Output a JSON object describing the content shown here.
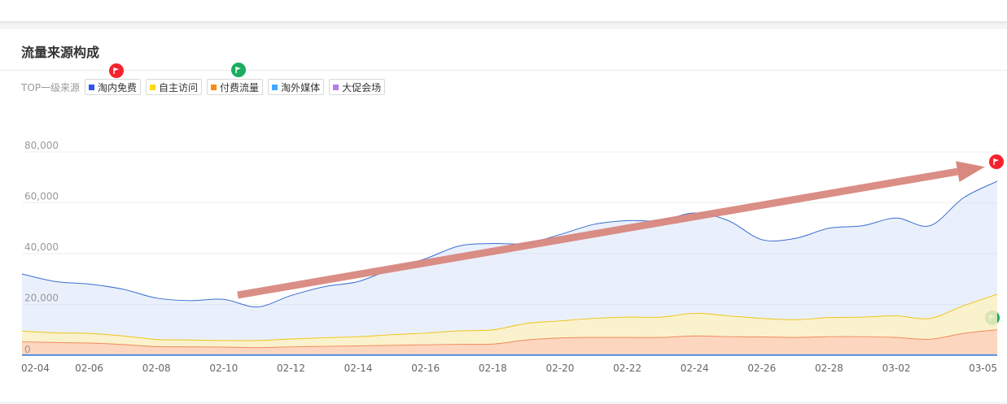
{
  "header": {
    "title": "流量来源构成"
  },
  "legend": {
    "label": "TOP一级来源",
    "items": [
      {
        "label": "淘内免费",
        "color": "#2f54eb"
      },
      {
        "label": "自主访问",
        "color": "#fadb14"
      },
      {
        "label": "付费流量",
        "color": "#fa8c16"
      },
      {
        "label": "淘外媒体",
        "color": "#40a9ff"
      },
      {
        "label": "大促会场",
        "color": "#b37feb"
      }
    ]
  },
  "flags": {
    "red_color": "#f5222d",
    "green_color": "#1aad5e"
  },
  "chart_data": {
    "type": "area",
    "title": "",
    "xlabel": "",
    "ylabel": "",
    "ylim": [
      0,
      80000
    ],
    "yticks": [
      "0",
      "20,000",
      "40,000",
      "60,000",
      "80,000"
    ],
    "xticks": [
      "02-04",
      "02-06",
      "02-08",
      "02-10",
      "02-12",
      "02-14",
      "02-16",
      "02-18",
      "02-20",
      "02-22",
      "02-24",
      "02-26",
      "02-28",
      "03-02",
      "03-05"
    ],
    "x": [
      "02-04",
      "02-05",
      "02-06",
      "02-07",
      "02-08",
      "02-09",
      "02-10",
      "02-11",
      "02-12",
      "02-13",
      "02-14",
      "02-15",
      "02-16",
      "02-17",
      "02-18",
      "02-19",
      "02-20",
      "02-21",
      "02-22",
      "02-23",
      "02-24",
      "02-25",
      "02-26",
      "02-27",
      "02-28",
      "03-01",
      "03-02",
      "03-03",
      "03-04",
      "03-05"
    ],
    "series": [
      {
        "name": "淘内免费",
        "color": "#3a6fcf",
        "values": [
          32000,
          29000,
          28000,
          26000,
          22500,
          21500,
          22000,
          19000,
          23500,
          27000,
          29000,
          34000,
          38000,
          43000,
          44000,
          44000,
          47500,
          51500,
          53000,
          53000,
          56000,
          53000,
          45500,
          46000,
          50000,
          51000,
          54000,
          51000,
          62000,
          68500
        ]
      },
      {
        "name": "自主访问",
        "color": "#f0c419",
        "values": [
          9500,
          8800,
          8600,
          7600,
          6200,
          6000,
          5800,
          5800,
          6400,
          6900,
          7300,
          8100,
          8700,
          9600,
          10000,
          12500,
          13500,
          14500,
          15000,
          15000,
          16500,
          15500,
          14500,
          14000,
          14800,
          15000,
          15500,
          14500,
          19500,
          24000
        ]
      },
      {
        "name": "付费流量",
        "color": "#f08a5d",
        "values": [
          5300,
          5000,
          4800,
          4200,
          3400,
          3300,
          3200,
          3000,
          3300,
          3500,
          3700,
          3900,
          4100,
          4300,
          4400,
          6000,
          6800,
          7000,
          7000,
          7000,
          7600,
          7300,
          7200,
          7000,
          7300,
          7300,
          7000,
          6300,
          8600,
          10000
        ]
      },
      {
        "name": "淘外媒体",
        "color": "#40a9ff",
        "values": [
          200,
          200,
          200,
          200,
          200,
          200,
          200,
          200,
          200,
          200,
          200,
          200,
          200,
          200,
          200,
          200,
          200,
          200,
          200,
          200,
          200,
          200,
          200,
          200,
          200,
          200,
          200,
          200,
          200,
          200
        ]
      },
      {
        "name": "大促会场",
        "color": "#b37feb",
        "values": [
          0,
          0,
          0,
          0,
          0,
          0,
          0,
          0,
          0,
          0,
          0,
          0,
          0,
          0,
          0,
          0,
          0,
          0,
          0,
          0,
          0,
          0,
          0,
          0,
          0,
          0,
          0,
          0,
          0,
          0
        ]
      }
    ],
    "grid": true,
    "legend_position": "top-left"
  },
  "annotation": {
    "arrow_color": "#d9887f"
  }
}
